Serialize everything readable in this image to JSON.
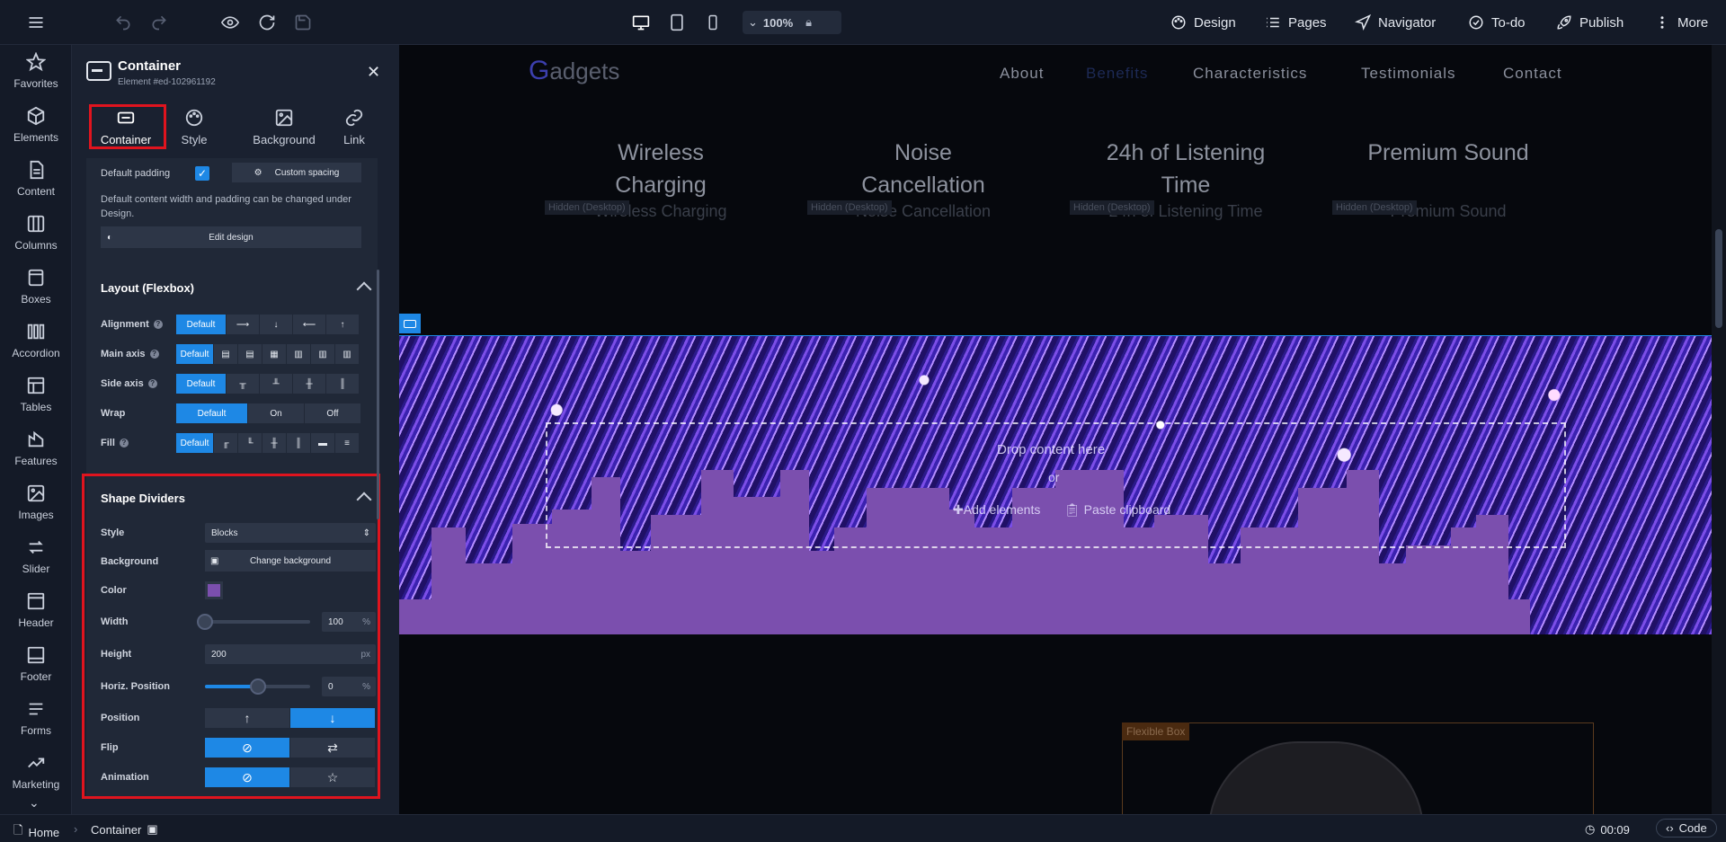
{
  "topbar": {
    "menu": [
      {
        "label": "Design",
        "icon": "palette-icon"
      },
      {
        "label": "Pages",
        "icon": "list-icon"
      },
      {
        "label": "Navigator",
        "icon": "navigation-icon"
      },
      {
        "label": "To-do",
        "icon": "check-circle-icon"
      },
      {
        "label": "Publish",
        "icon": "rocket-icon"
      },
      {
        "label": "More",
        "icon": "more-vertical-icon"
      }
    ],
    "zoom": "100%"
  },
  "leftnav": [
    {
      "label": "Favorites",
      "icon": "star-icon"
    },
    {
      "label": "Elements",
      "icon": "cube-icon"
    },
    {
      "label": "Content",
      "icon": "document-icon"
    },
    {
      "label": "Columns",
      "icon": "columns-icon"
    },
    {
      "label": "Boxes",
      "icon": "box-icon"
    },
    {
      "label": "Accordion",
      "icon": "accordion-icon"
    },
    {
      "label": "Tables",
      "icon": "table-icon"
    },
    {
      "label": "Features",
      "icon": "features-icon"
    },
    {
      "label": "Images",
      "icon": "image-icon"
    },
    {
      "label": "Slider",
      "icon": "slider-icon"
    },
    {
      "label": "Header",
      "icon": "header-icon"
    },
    {
      "label": "Footer",
      "icon": "footer-icon"
    },
    {
      "label": "Forms",
      "icon": "forms-icon"
    },
    {
      "label": "Marketing",
      "icon": "marketing-icon"
    }
  ],
  "panel": {
    "title": "Container",
    "element_id": "Element #ed-102961192",
    "tabs": [
      {
        "label": "Container",
        "icon": "container-icon"
      },
      {
        "label": "Style",
        "icon": "palette-icon"
      },
      {
        "label": "Background",
        "icon": "image-icon"
      },
      {
        "label": "Link",
        "icon": "link-icon"
      }
    ],
    "general": {
      "default_padding_label": "Default padding",
      "default_padding_checked": true,
      "custom_spacing_label": "Custom spacing",
      "note": "Default content width and padding can be changed under Design.",
      "edit_design_label": "Edit design"
    },
    "layout": {
      "title": "Layout (Flexbox)",
      "alignment_label": "Alignment",
      "main_axis_label": "Main axis",
      "side_axis_label": "Side axis",
      "wrap_label": "Wrap",
      "fill_label": "Fill",
      "default_label": "Default",
      "on_label": "On",
      "off_label": "Off"
    },
    "shape_dividers": {
      "title": "Shape Dividers",
      "style_label": "Style",
      "style_value": "Blocks",
      "background_label": "Background",
      "change_background_label": "Change background",
      "color_label": "Color",
      "color_value": "#7b4fae",
      "width_label": "Width",
      "width_value": "100",
      "width_unit": "%",
      "width_slider_fraction": 0.0,
      "height_label": "Height",
      "height_value": "200",
      "height_unit": "px",
      "horiz_label": "Horiz. Position",
      "horiz_value": "0",
      "horiz_unit": "%",
      "horiz_slider_fraction": 0.5,
      "position_label": "Position",
      "position_selected": "bottom",
      "flip_label": "Flip",
      "flip_selected": "none",
      "animation_label": "Animation",
      "animation_selected": "none"
    }
  },
  "canvas": {
    "logo_first": "G",
    "logo_rest": "adgets",
    "nav": [
      "About",
      "Benefits",
      "Characteristics",
      "Testimonials",
      "Contact"
    ],
    "features": [
      {
        "title": "Wireless Charging",
        "sub": "Wireless Charging"
      },
      {
        "title": "Noise Cancellation",
        "sub": "Noise Cancellation"
      },
      {
        "title": "24h of Listening Time",
        "sub": "24h of Listening Time"
      },
      {
        "title": "Premium Sound",
        "sub": "Premium Sound"
      }
    ],
    "hidden_badge": "Hidden (Desktop)",
    "drop_content": "Drop content here",
    "or": "or",
    "add_elements": "Add elements",
    "paste_clipboard": "Paste clipboard",
    "flexible_box": "Flexible Box",
    "divider_color": "#7b4fae"
  },
  "bottombar": {
    "home": "Home",
    "container": "Container",
    "timer": "00:09",
    "code": "Code"
  }
}
